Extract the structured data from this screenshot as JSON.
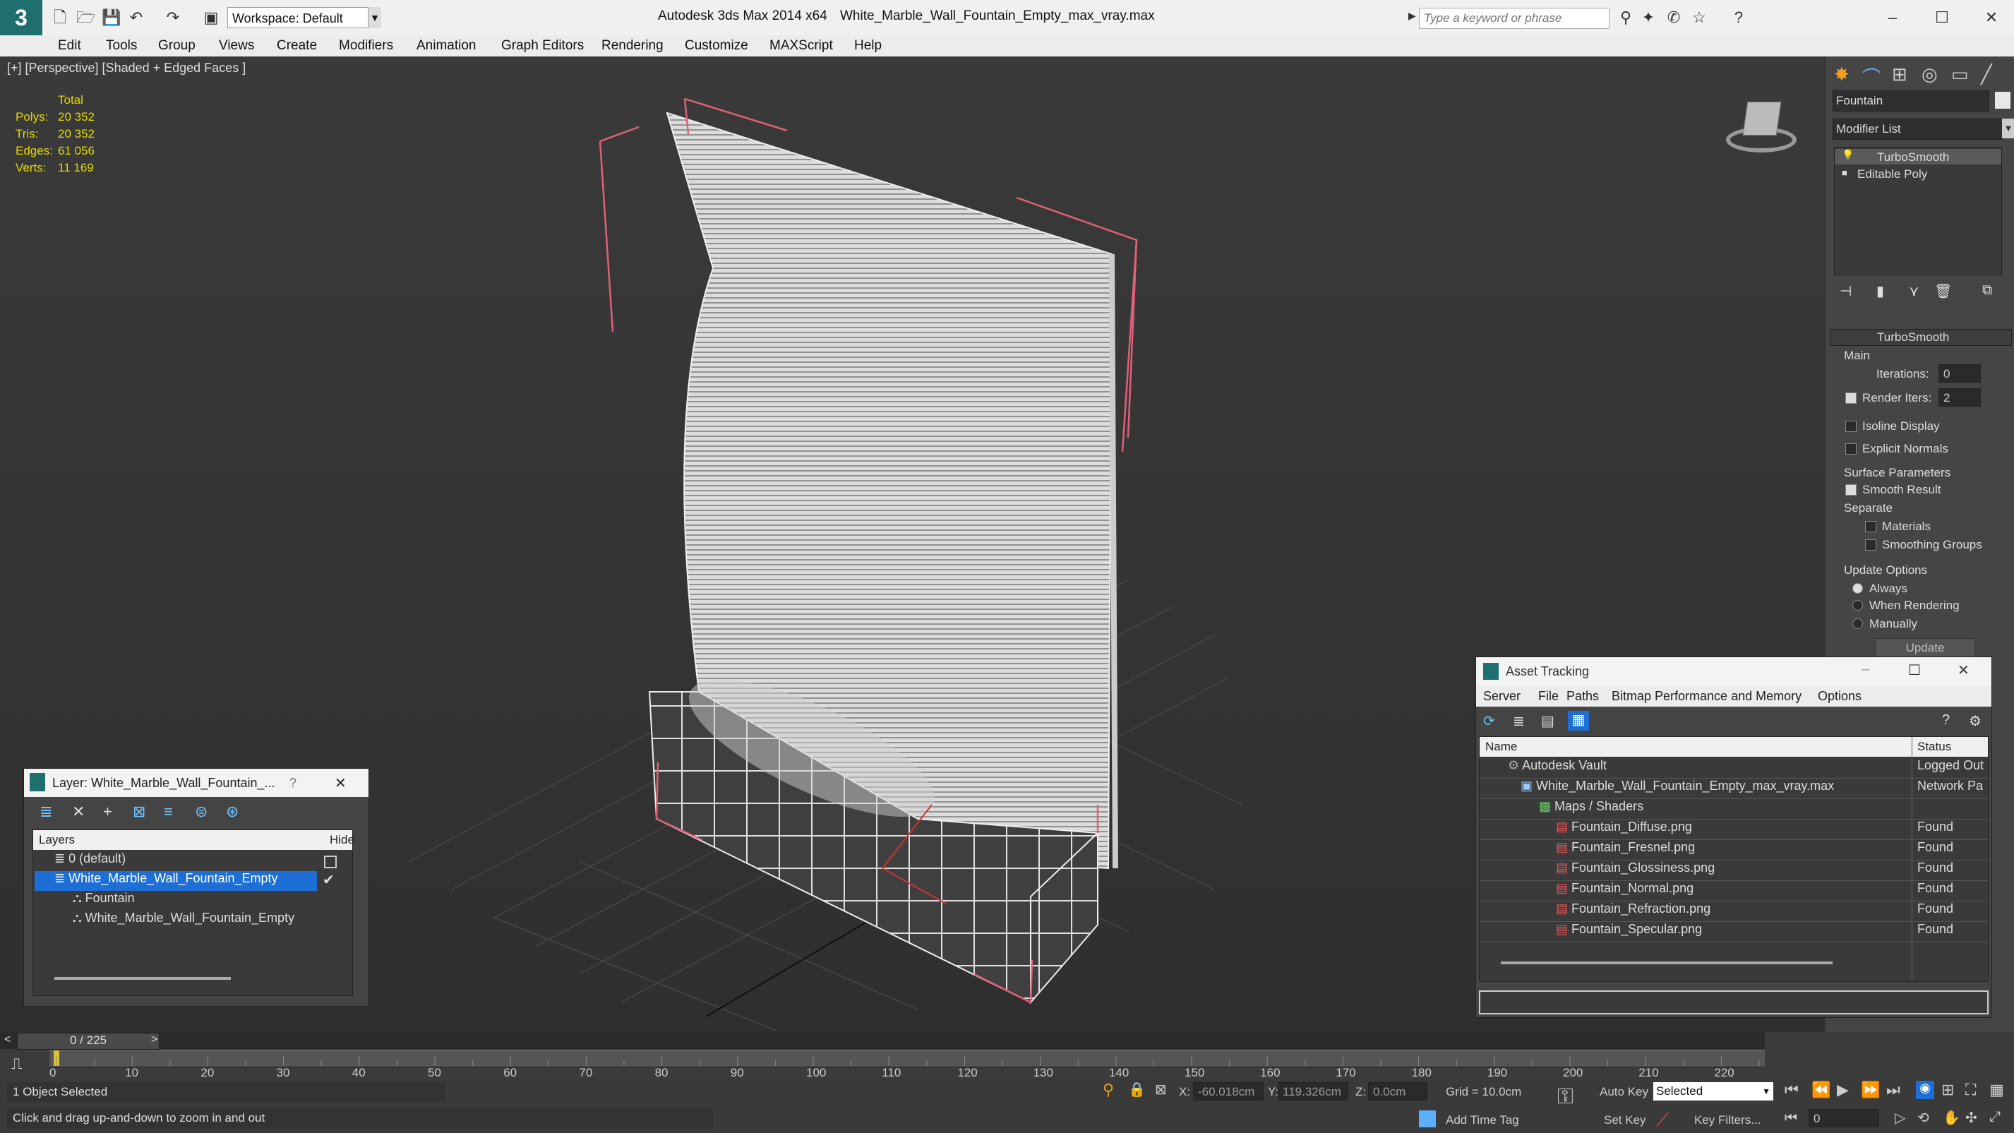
{
  "app": {
    "title": "Autodesk 3ds Max  2014 x64",
    "file_name": "White_Marble_Wall_Fountain_Empty_max_vray.max",
    "workspace": "Workspace: Default",
    "search_placeholder": "Type a keyword or phrase"
  },
  "menu": [
    "Edit",
    "Tools",
    "Group",
    "Views",
    "Create",
    "Modifiers",
    "Animation",
    "Graph Editors",
    "Rendering",
    "Customize",
    "MAXScript",
    "Help"
  ],
  "viewport": {
    "label": "[+] [Perspective] [Shaded + Edged Faces ]",
    "stats": {
      "header": "Total",
      "polys_label": "Polys:",
      "polys": "20 352",
      "tris_label": "Tris:",
      "tris": "20 352",
      "edges_label": "Edges:",
      "edges": "61 056",
      "verts_label": "Verts:",
      "verts": "11 169"
    }
  },
  "command_panel": {
    "object_name": "Fountain",
    "modifier_list": "Modifier List",
    "stack": [
      "TurboSmooth",
      "Editable Poly"
    ],
    "rollout_title": "TurboSmooth",
    "main_label": "Main",
    "iterations_label": "Iterations:",
    "iterations": "0",
    "render_iters_label": "Render Iters:",
    "render_iters": "2",
    "isoline": "Isoline Display",
    "explicit_normals": "Explicit Normals",
    "surface_params": "Surface Parameters",
    "smooth_result": "Smooth Result",
    "separate": "Separate",
    "materials": "Materials",
    "smoothing_groups": "Smoothing Groups",
    "update_options": "Update Options",
    "always": "Always",
    "when_rendering": "When Rendering",
    "manually": "Manually",
    "update_button": "Update"
  },
  "layer_window": {
    "title": "Layer: White_Marble_Wall_Fountain_...",
    "help": "?",
    "col_layers": "Layers",
    "col_hide": "Hide",
    "rows": [
      "0 (default)",
      "White_Marble_Wall_Fountain_Empty",
      "Fountain",
      "White_Marble_Wall_Fountain_Empty"
    ]
  },
  "asset_window": {
    "title": "Asset Tracking",
    "menu": [
      "Server",
      "File",
      "Paths",
      "Bitmap Performance and Memory",
      "Options"
    ],
    "col_name": "Name",
    "col_status": "Status",
    "rows": [
      {
        "name": "Autodesk Vault",
        "status": "Logged Out"
      },
      {
        "name": "White_Marble_Wall_Fountain_Empty_max_vray.max",
        "status": "Network Pa"
      },
      {
        "name": "Maps / Shaders",
        "status": ""
      },
      {
        "name": "Fountain_Diffuse.png",
        "status": "Found"
      },
      {
        "name": "Fountain_Fresnel.png",
        "status": "Found"
      },
      {
        "name": "Fountain_Glossiness.png",
        "status": "Found"
      },
      {
        "name": "Fountain_Normal.png",
        "status": "Found"
      },
      {
        "name": "Fountain_Refraction.png",
        "status": "Found"
      },
      {
        "name": "Fountain_Specular.png",
        "status": "Found"
      }
    ]
  },
  "timeline": {
    "frame": "0 / 225",
    "ticks": [
      "0",
      "10",
      "20",
      "30",
      "40",
      "50",
      "60",
      "70",
      "80",
      "90",
      "100",
      "110",
      "120",
      "130",
      "140",
      "150",
      "160",
      "170",
      "180",
      "190",
      "200",
      "210",
      "220"
    ]
  },
  "status": {
    "selection": "1 Object Selected",
    "hint": "Click and drag up-and-down to zoom in and out",
    "x_label": "X:",
    "x": "-60.018cm",
    "y_label": "Y:",
    "y": "119.326cm",
    "z_label": "Z:",
    "z": "0.0cm",
    "grid": "Grid = 10.0cm",
    "auto_key": "Auto Key",
    "selected": "Selected",
    "set_key": "Set Key",
    "key_filters": "Key Filters...",
    "add_time_tag": "Add Time Tag",
    "frame_field": "0"
  },
  "colors": {
    "accent": "#1d6fd6",
    "stats": "#e6d800"
  }
}
